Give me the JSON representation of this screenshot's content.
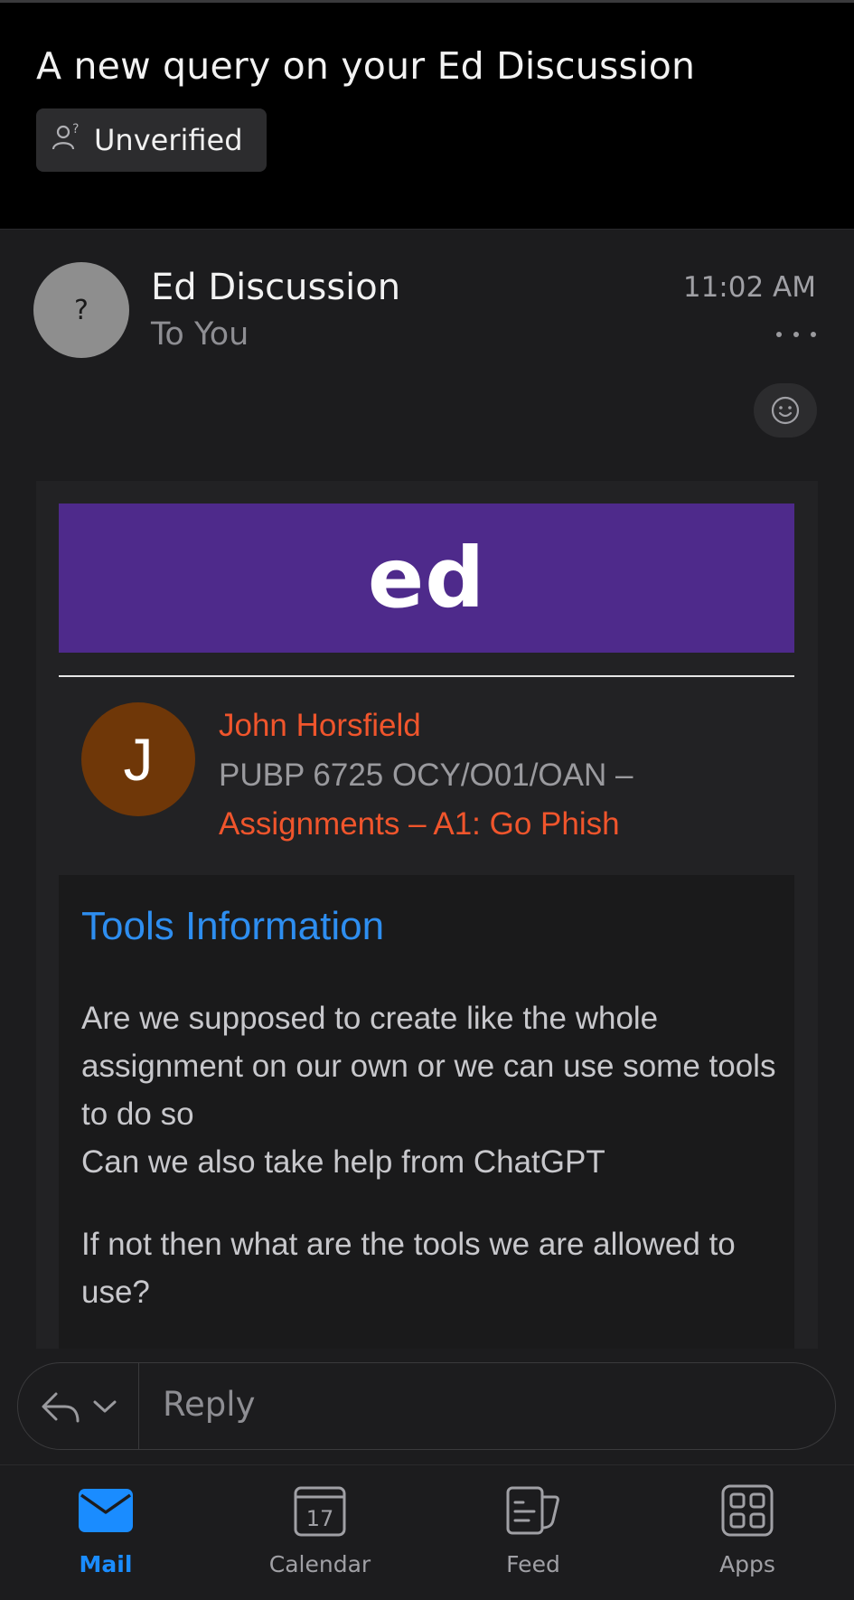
{
  "header": {
    "subject": "A new query on your Ed Discussion",
    "badge_label": "Unverified",
    "badge_icon": "unverified-person-icon"
  },
  "message": {
    "avatar_initial": "?",
    "sender": "Ed Discussion",
    "recipient": "To You",
    "time": "11:02 AM",
    "more_icon": "ellipsis-icon",
    "react_icon": "smiley-icon"
  },
  "email_body": {
    "brand_logo": "ed",
    "brand_color": "#4e2a8b",
    "author_initial": "J",
    "author": "John Horsfield",
    "course": "PUBP 6725 OCY/O01/OAN –",
    "thread": "Assignments – A1: Go Phish",
    "post_title": "Tools Information",
    "paragraph_1": "Are we supposed to create like the whole assignment on our own or we can use some tools to do so\nCan we also take help from ChatGPT",
    "paragraph_2": "If not then what are the tools we are allowed to use?"
  },
  "reply": {
    "placeholder": "Reply",
    "reply_icon": "reply-arrow-icon",
    "options_icon": "chevron-down-icon"
  },
  "tabs": [
    {
      "label": "Mail",
      "icon": "mail-icon",
      "active": true
    },
    {
      "label": "Calendar",
      "icon": "calendar-icon",
      "day": "17",
      "active": false
    },
    {
      "label": "Feed",
      "icon": "feed-icon",
      "active": false
    },
    {
      "label": "Apps",
      "icon": "apps-icon",
      "active": false
    }
  ],
  "colors": {
    "accent": "#1a8cff",
    "author_link": "#f0552c",
    "title_link": "#2e8ef0"
  }
}
